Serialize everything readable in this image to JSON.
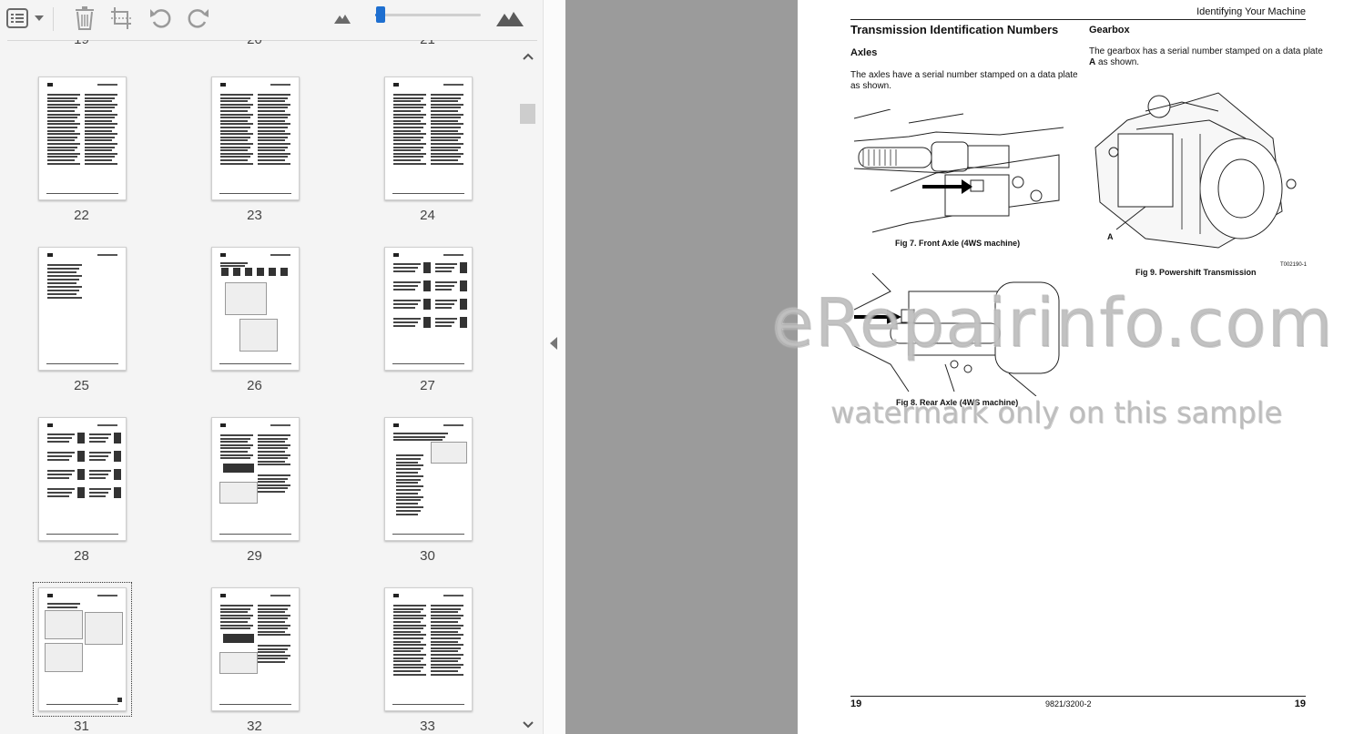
{
  "toolbar": {
    "icons": [
      "sidebar-view-icon",
      "chevron-down-icon",
      "delete-icon",
      "crop-icon",
      "rotate-left-icon",
      "rotate-right-icon",
      "zoom-out-icon",
      "zoom-in-icon"
    ],
    "zoom_level": 0.05,
    "accent_color": "#1e6fd0"
  },
  "sidebar": {
    "partial_numbers": [
      "19",
      "20",
      "21"
    ],
    "thumbnails": [
      {
        "number": "22",
        "kind": "text"
      },
      {
        "number": "23",
        "kind": "text"
      },
      {
        "number": "24",
        "kind": "text"
      },
      {
        "number": "25",
        "kind": "sparse"
      },
      {
        "number": "26",
        "kind": "diagram"
      },
      {
        "number": "27",
        "kind": "symbols"
      },
      {
        "number": "28",
        "kind": "symbols"
      },
      {
        "number": "29",
        "kind": "mixed"
      },
      {
        "number": "30",
        "kind": "table"
      },
      {
        "number": "31",
        "kind": "figures",
        "selected": true
      },
      {
        "number": "32",
        "kind": "mixed"
      },
      {
        "number": "33",
        "kind": "text"
      }
    ]
  },
  "document": {
    "running_header": "Identifying Your Machine",
    "heading": "Transmission Identification Numbers",
    "axles_heading": "Axles",
    "axles_text_line1": "The axles have a serial number stamped on a data plate",
    "axles_text_line2": "as shown.",
    "gearbox_heading": "Gearbox",
    "gearbox_text_line1": "The gearbox has a serial number stamped on a data plate",
    "gearbox_text_bold": "A",
    "gearbox_text_line2": " as shown.",
    "fig7_caption": "Fig 7. Front Axle (4WS machine)",
    "fig8_caption": "Fig 8. Rear Axle (4WS machine)",
    "fig9_caption": "Fig 9. Powershift Transmission",
    "fig9_label": "A",
    "fig9_ref": "T002190-1",
    "footer_left": "19",
    "footer_center": "9821/3200-2",
    "footer_right": "19"
  },
  "watermark": {
    "line1": "eRepairinfo.com",
    "line2": "watermark only on this sample"
  }
}
